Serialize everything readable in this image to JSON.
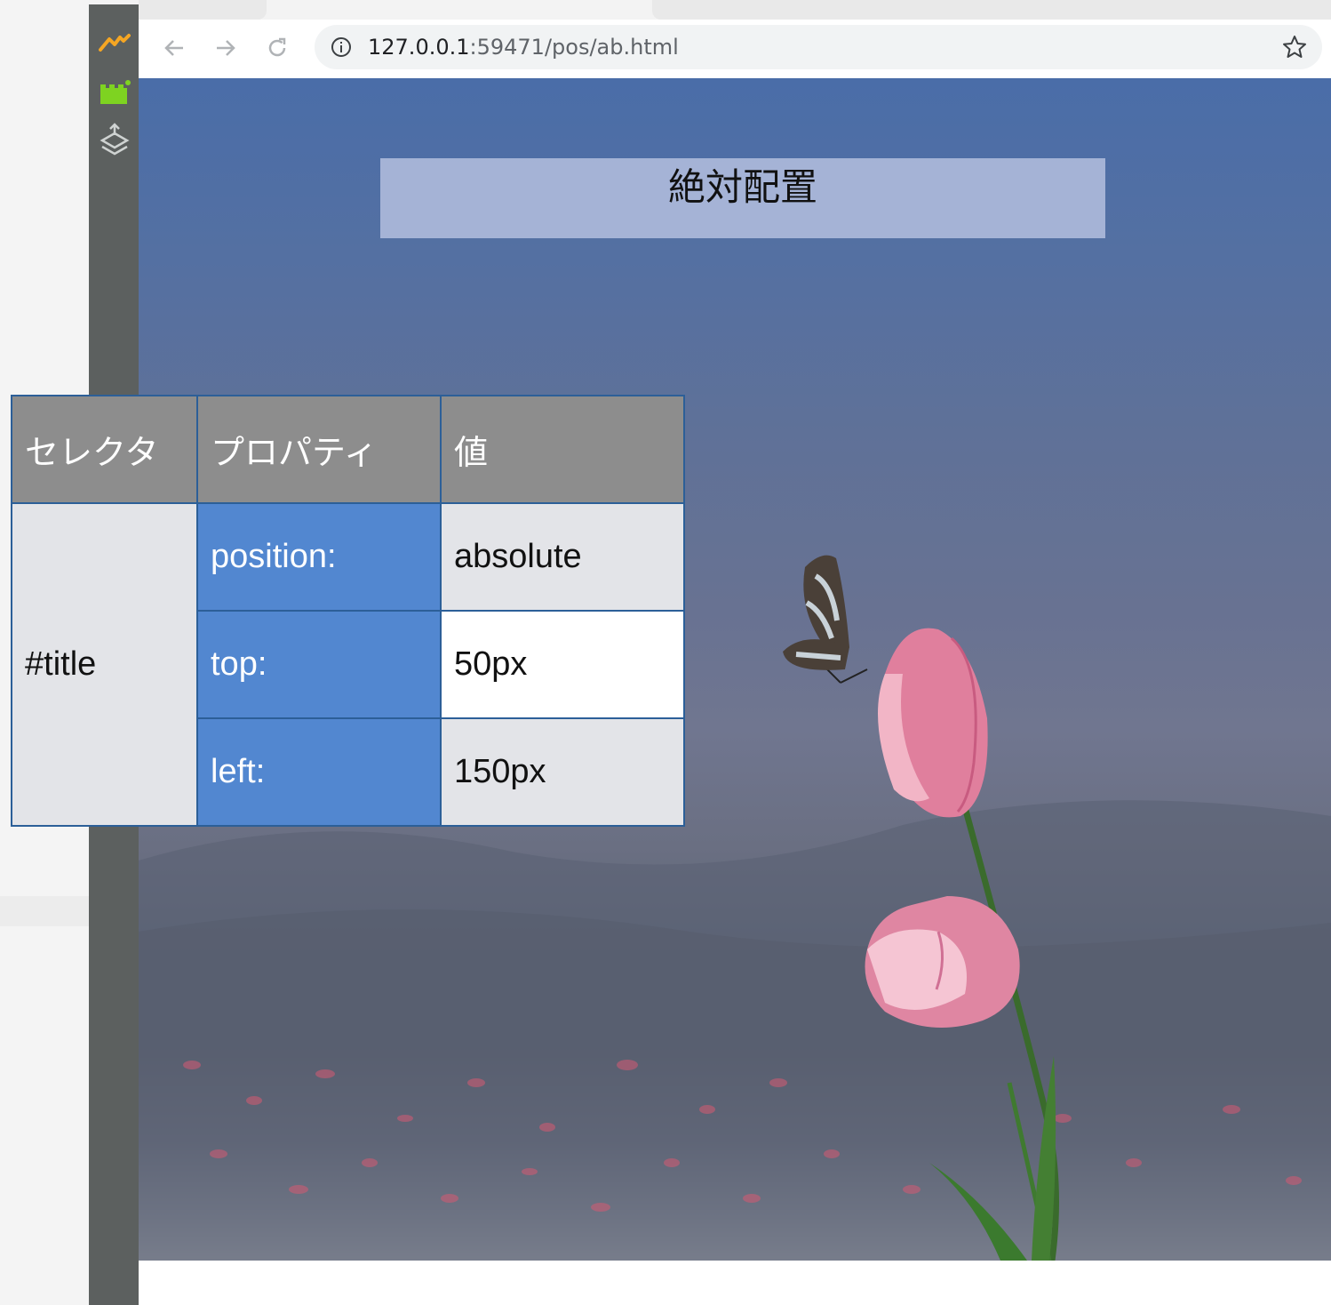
{
  "browser": {
    "url_prefix": "127.0.0.1",
    "url_rest": ":59471/pos/ab.html"
  },
  "page": {
    "title": "絶対配置"
  },
  "table": {
    "headers": [
      "セレクタ",
      "プロパティ",
      "値"
    ],
    "selector": "#title",
    "rows": [
      {
        "property": "position:",
        "value": "absolute"
      },
      {
        "property": "top:",
        "value": "50px"
      },
      {
        "property": "left:",
        "value": "150px"
      }
    ]
  },
  "colors": {
    "accent_orange": "#f5a623",
    "accent_green": "#7ed321",
    "header_gray": "#8d8d8d",
    "property_blue": "#5287d0",
    "table_border": "#2c5f98"
  },
  "icons": [
    "activity-icon",
    "extension-icon",
    "layers-icon",
    "back-arrow-icon",
    "forward-arrow-icon",
    "reload-icon",
    "info-icon",
    "star-icon",
    "butterfly-image",
    "tulip-image"
  ]
}
